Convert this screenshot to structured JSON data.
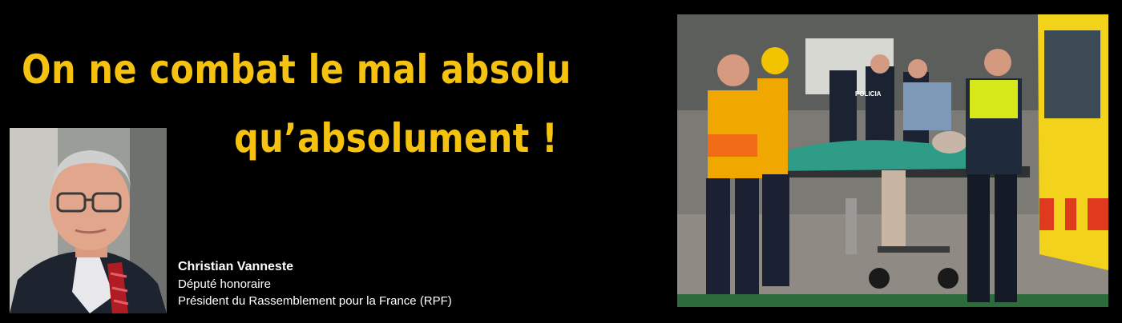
{
  "headline": {
    "line1": "On ne combat le mal absolu",
    "line2": "qu’absolument !"
  },
  "author": {
    "name": "Christian Vanneste",
    "title": "Député honoraire",
    "role": "Président du Rassemblement pour la France (RPF)"
  },
  "photo": {
    "police_label": "POLICIA"
  },
  "colors": {
    "background": "#000000",
    "headline": "#f5c20f",
    "caption": "#ffffff"
  }
}
